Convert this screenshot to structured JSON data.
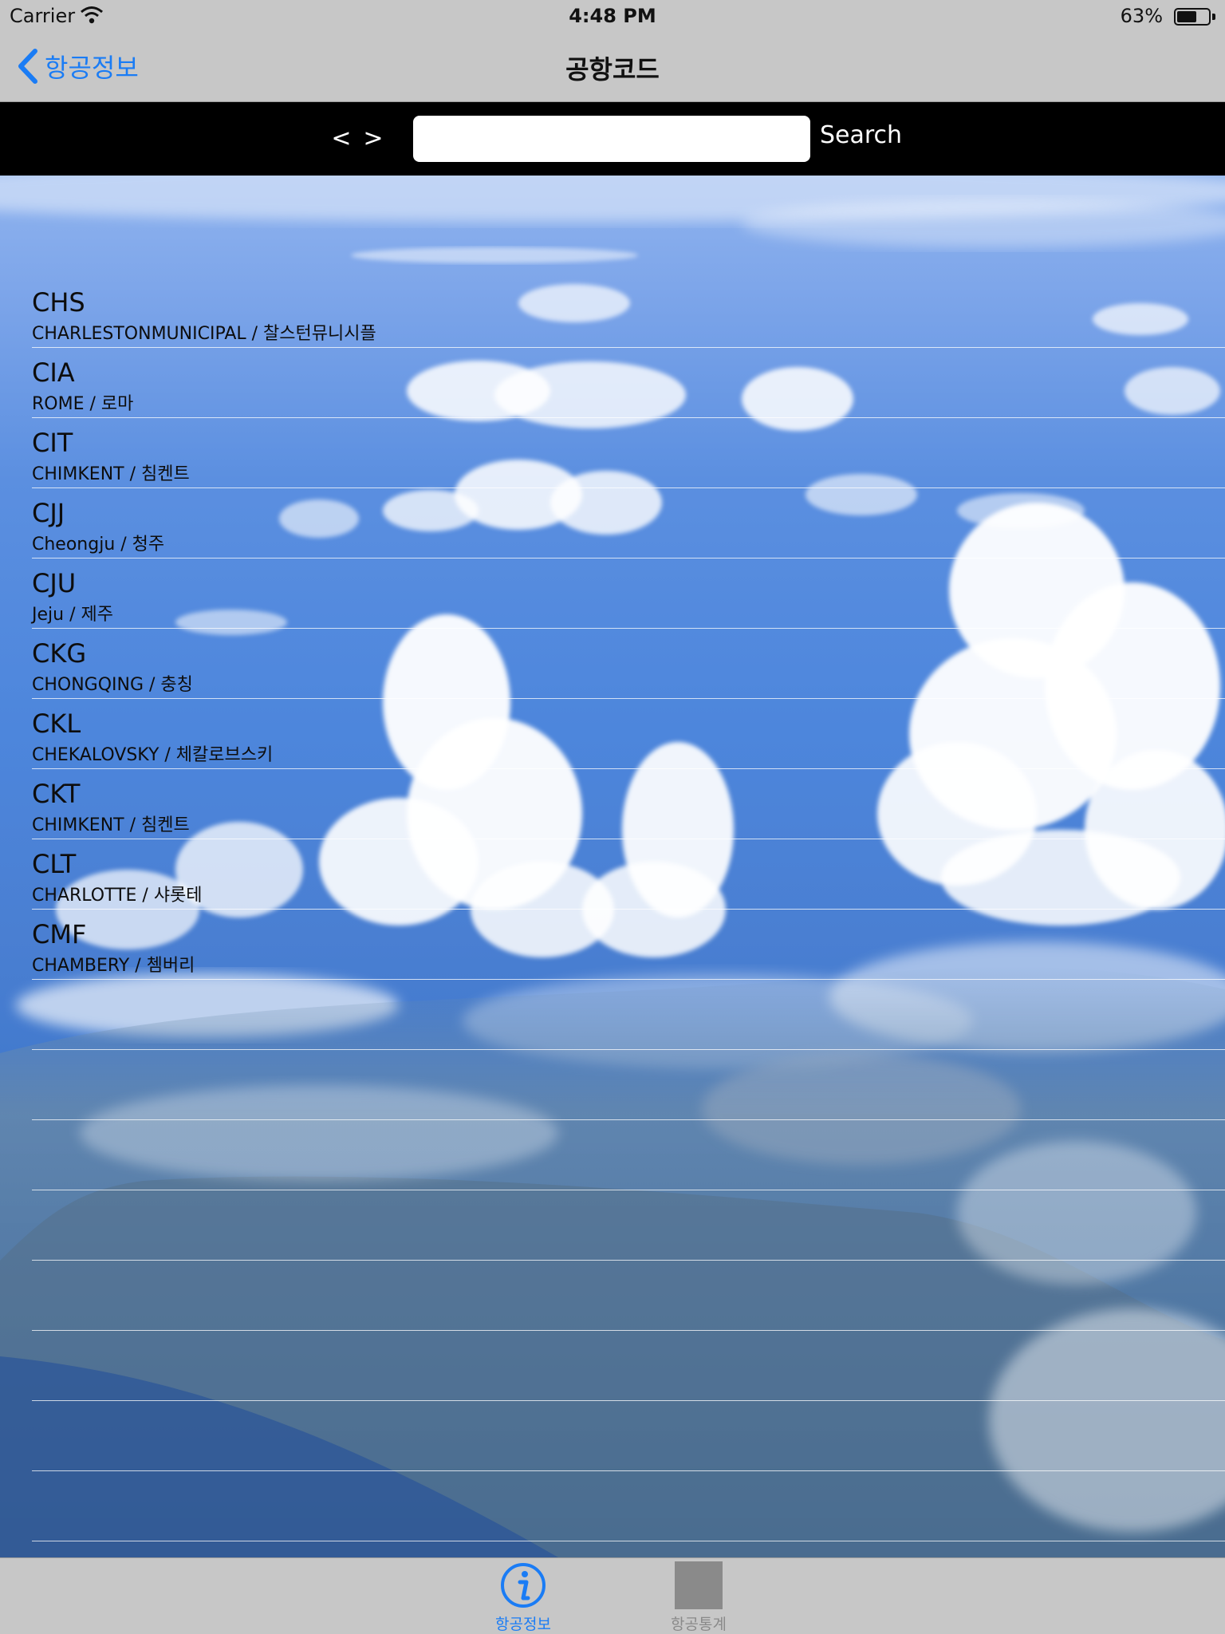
{
  "status_bar": {
    "carrier": "Carrier",
    "time": "4:48 PM",
    "battery_percent": "63%",
    "battery_level": 0.63
  },
  "nav": {
    "back_label": "항공정보",
    "title": "공항코드"
  },
  "search": {
    "prev_label": "<",
    "next_label": ">",
    "query": "",
    "button_label": "Search"
  },
  "airports": [
    {
      "code": "CHS",
      "name": "CHARLESTONMUNICIPAL / 찰스턴뮤니시플"
    },
    {
      "code": "CIA",
      "name": "ROME / 로마"
    },
    {
      "code": "CIT",
      "name": "CHIMKENT / 침켄트"
    },
    {
      "code": "CJJ",
      "name": "Cheongju / 청주"
    },
    {
      "code": "CJU",
      "name": "Jeju / 제주"
    },
    {
      "code": "CKG",
      "name": "CHONGQING / 충칭"
    },
    {
      "code": "CKL",
      "name": "CHEKALOVSKY / 체칼로브스키"
    },
    {
      "code": "CKT",
      "name": "CHIMKENT / 침켄트"
    },
    {
      "code": "CLT",
      "name": "CHARLOTTE / 샤롯테"
    },
    {
      "code": "CMF",
      "name": "CHAMBERY / 쳄버리"
    }
  ],
  "tabs": [
    {
      "label": "항공정보",
      "icon": "info-icon",
      "selected": true
    },
    {
      "label": "항공통계",
      "icon": "stats-icon",
      "selected": false
    }
  ],
  "colors": {
    "accent": "#1a7cf5",
    "bar_background": "#c7c7c7",
    "search_bar_background": "#000000"
  }
}
